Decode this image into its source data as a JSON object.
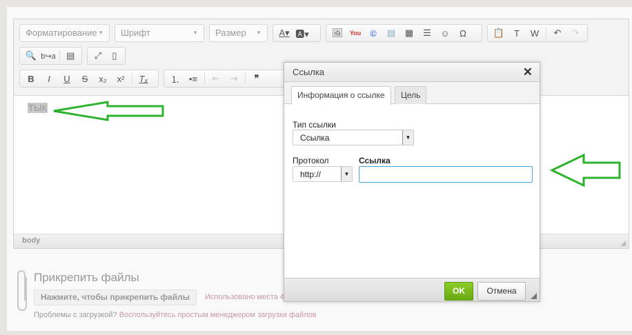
{
  "toolbar": {
    "format": "Форматирование",
    "font": "Шрифт",
    "size": "Размер"
  },
  "editor": {
    "content": "ТЫК",
    "path": "body"
  },
  "attach": {
    "title": "Прикрепить файлы",
    "button": "Нажмите, чтобы прикрепить файлы",
    "used": "Использовано места 4",
    "problem": "Проблемы с загрузкой?",
    "manager_link": "Воспользуйтесь простым менеджером загрузки файлов"
  },
  "dialog": {
    "title": "Ссылка",
    "tabs": [
      "Информация о ссылке",
      "Цель"
    ],
    "link_type_label": "Тип ссылки",
    "link_type_value": "Ссылка",
    "protocol_label": "Протокол",
    "protocol_value": "http://",
    "url_label": "Ссылка",
    "url_value": "",
    "ok": "OK",
    "cancel": "Отмена"
  },
  "colors": {
    "accent_green": "#6aa813",
    "arrow": "#2db32d"
  }
}
